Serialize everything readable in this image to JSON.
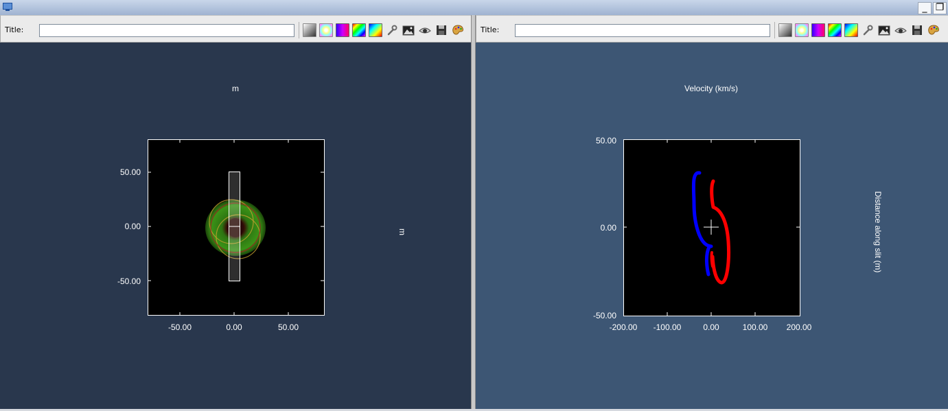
{
  "window": {
    "minimize_label": "_",
    "restore_label": "❐"
  },
  "left_panel": {
    "toolbar": {
      "title_label": "Title:",
      "title_value": "",
      "buttons": [
        {
          "name": "grayscale-colormap-icon"
        },
        {
          "name": "pastel-colormap-icon"
        },
        {
          "name": "purple-colormap-icon"
        },
        {
          "name": "rainbow-colormap-icon"
        },
        {
          "name": "spectrum-colormap-icon"
        },
        {
          "name": "wrench-icon"
        },
        {
          "name": "image-icon"
        },
        {
          "name": "eye-icon"
        },
        {
          "name": "save-icon"
        },
        {
          "name": "palette-icon"
        }
      ]
    },
    "background_color": "#29374d",
    "plot": {
      "top_label": "m",
      "right_label": "m",
      "x_ticks": [
        "-50.00",
        "0.00",
        "50.00"
      ],
      "y_ticks": [
        "50.00",
        "0.00",
        "-50.00"
      ]
    }
  },
  "right_panel": {
    "toolbar": {
      "title_label": "Title:",
      "title_value": ""
    },
    "background_color": "#3d5674",
    "plot": {
      "top_label": "Velocity (km/s)",
      "right_label": "Distance along slit (m)",
      "x_ticks": [
        "-200.00",
        "-100.00",
        "0.00",
        "100.00",
        "200.00"
      ],
      "y_ticks": [
        "50.00",
        "0.00",
        "-50.00"
      ]
    }
  }
}
